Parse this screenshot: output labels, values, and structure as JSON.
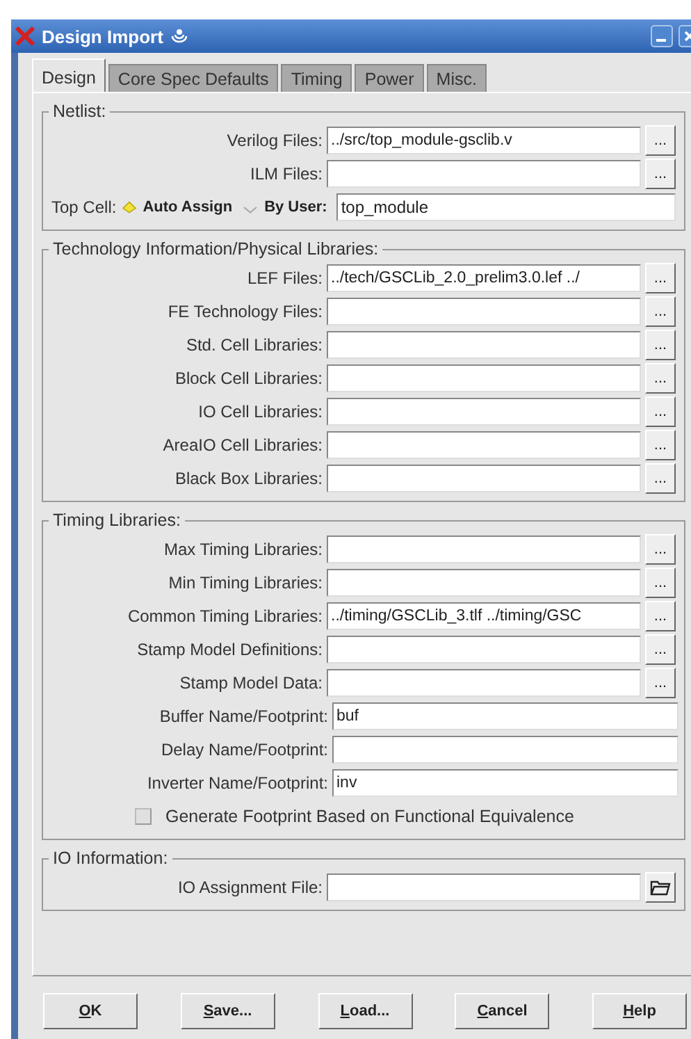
{
  "window": {
    "title": "Design Import"
  },
  "tabs": [
    {
      "label": "Design",
      "selected": true
    },
    {
      "label": "Core Spec Defaults",
      "selected": false
    },
    {
      "label": "Timing",
      "selected": false
    },
    {
      "label": "Power",
      "selected": false
    },
    {
      "label": "Misc.",
      "selected": false
    }
  ],
  "groups": [
    {
      "title": "Netlist:",
      "rows": [
        {
          "kind": "file",
          "label": "Verilog Files:",
          "value": "../src/top_module-gsclib.v",
          "button": "..."
        },
        {
          "kind": "file",
          "label": "ILM Files:",
          "button": "..."
        },
        {
          "kind": "radio",
          "label": "Top Cell:",
          "options": [
            {
              "label": "Auto Assign",
              "selected": true
            },
            {
              "label": "By User:",
              "selected": false
            }
          ],
          "value": "top_module"
        }
      ]
    },
    {
      "title": "Technology Information/Physical Libraries:",
      "rows": [
        {
          "kind": "file",
          "label": "LEF Files:",
          "value": "../tech/GSCLib_2.0_prelim3.0.lef ../",
          "button": "..."
        },
        {
          "kind": "file",
          "label": "FE Technology Files:",
          "button": "..."
        },
        {
          "kind": "file",
          "label": "Std. Cell Libraries:",
          "button": "..."
        },
        {
          "kind": "file",
          "label": "Block Cell Libraries:",
          "button": "..."
        },
        {
          "kind": "file",
          "label": "IO Cell Libraries:",
          "button": "..."
        },
        {
          "kind": "file",
          "label": "AreaIO Cell Libraries:",
          "button": "..."
        },
        {
          "kind": "file",
          "label": "Black Box Libraries:",
          "button": "..."
        }
      ]
    },
    {
      "title": "Timing Libraries:",
      "rows": [
        {
          "kind": "file",
          "label": "Max Timing Libraries:",
          "button": "..."
        },
        {
          "kind": "file",
          "label": "Min Timing Libraries:",
          "button": "..."
        },
        {
          "kind": "file",
          "label": "Common Timing Libraries:",
          "value": "../timing/GSCLib_3.tlf ../timing/GSC",
          "button": "..."
        },
        {
          "kind": "file",
          "label": "Stamp Model Definitions:",
          "button": "..."
        },
        {
          "kind": "file",
          "label": "Stamp Model Data:",
          "button": "..."
        },
        {
          "kind": "text",
          "label": "Buffer Name/Footprint:",
          "value": "buf"
        },
        {
          "kind": "text",
          "label": "Delay Name/Footprint:"
        },
        {
          "kind": "text",
          "label": "Inverter Name/Footprint:",
          "value": "inv"
        },
        {
          "kind": "checkbox",
          "label": "Generate Footprint Based on Functional Equivalence",
          "checked": false
        }
      ]
    },
    {
      "title": "IO Information:",
      "rows": [
        {
          "kind": "folder",
          "label": "IO Assignment File:"
        }
      ]
    }
  ],
  "buttons": [
    {
      "access_key": "O",
      "label_rest": "K"
    },
    {
      "access_key": "S",
      "label_rest": "ave..."
    },
    {
      "access_key": "L",
      "label_rest": "oad..."
    },
    {
      "access_key": "C",
      "label_rest": "ancel"
    },
    {
      "access_key": "H",
      "label_rest": "elp"
    }
  ]
}
